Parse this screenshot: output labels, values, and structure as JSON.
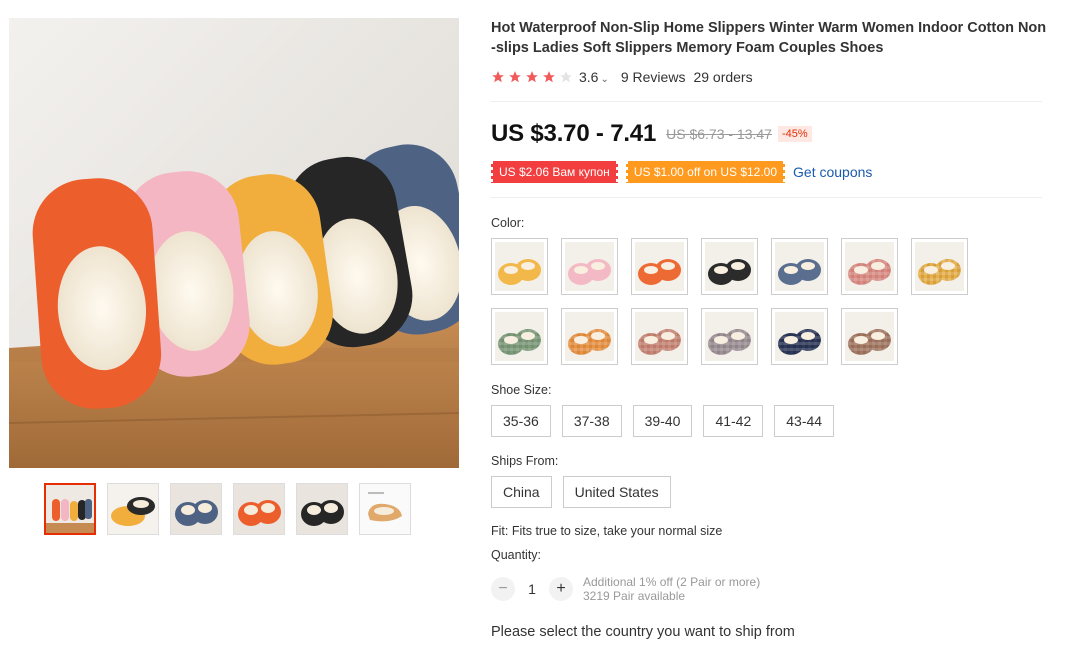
{
  "product": {
    "title": "Hot Waterproof Non-Slip Home Slippers Winter Warm Women Indoor Cotton Non-slips Ladies Soft Slippers Memory Foam Couples Shoes",
    "rating": "3.6",
    "rating_stars": 4,
    "reviews": "9 Reviews",
    "orders": "29 orders"
  },
  "price": {
    "current": "US $3.70 - 7.41",
    "original": "US $6.73 - 13.47",
    "discount": "-45%"
  },
  "coupons": {
    "store_coupon": "US $2.06 Вам купон",
    "select_coupon": "US $1.00 off on US $12.00",
    "get_coupons": "Get coupons"
  },
  "color": {
    "label": "Color:",
    "swatches": [
      {
        "name": "yellow",
        "c1": "#f2b84a",
        "c2": "#e8a63a"
      },
      {
        "name": "pink",
        "c1": "#f3b9c4",
        "c2": "#e7a1b0"
      },
      {
        "name": "orange",
        "c1": "#ee6a35",
        "c2": "#d9552a"
      },
      {
        "name": "black",
        "c1": "#2b2b2b",
        "c2": "#1d1d1d"
      },
      {
        "name": "blue",
        "c1": "#5a6f8f",
        "c2": "#4a5e7d"
      },
      {
        "name": "pink-plaid",
        "c1": "#d98f86",
        "c2": "#c9786f"
      },
      {
        "name": "yellow-plaid",
        "c1": "#e7b149",
        "c2": "#c9923a"
      },
      {
        "name": "green-plaid",
        "c1": "#7d9a7b",
        "c2": "#6c8869"
      },
      {
        "name": "orange-plaid",
        "c1": "#e79446",
        "c2": "#d37f34"
      },
      {
        "name": "rose-plaid",
        "c1": "#c98778",
        "c2": "#b27364"
      },
      {
        "name": "grey-plaid",
        "c1": "#9d9296",
        "c2": "#877c80"
      },
      {
        "name": "navy-plaid",
        "c1": "#2f3a5a",
        "c2": "#222c47"
      },
      {
        "name": "brown-plaid",
        "c1": "#a37963",
        "c2": "#8e6653"
      }
    ]
  },
  "shoe_size": {
    "label": "Shoe Size:",
    "options": [
      "35-36",
      "37-38",
      "39-40",
      "41-42",
      "43-44"
    ]
  },
  "ships_from": {
    "label": "Ships From:",
    "options": [
      "China",
      "United States"
    ]
  },
  "fit": "Fit: Fits true to size, take your normal size",
  "quantity": {
    "label": "Quantity:",
    "value": "1",
    "minus": "−",
    "plus": "+",
    "note": "Additional 1% off (2 Pair or more)",
    "available": "3219 Pair available"
  },
  "ship_message": "Please select the country you want to ship from",
  "colors": {
    "accent": "#e62e04",
    "link": "#1a5bab",
    "star": "#f05a5a"
  }
}
